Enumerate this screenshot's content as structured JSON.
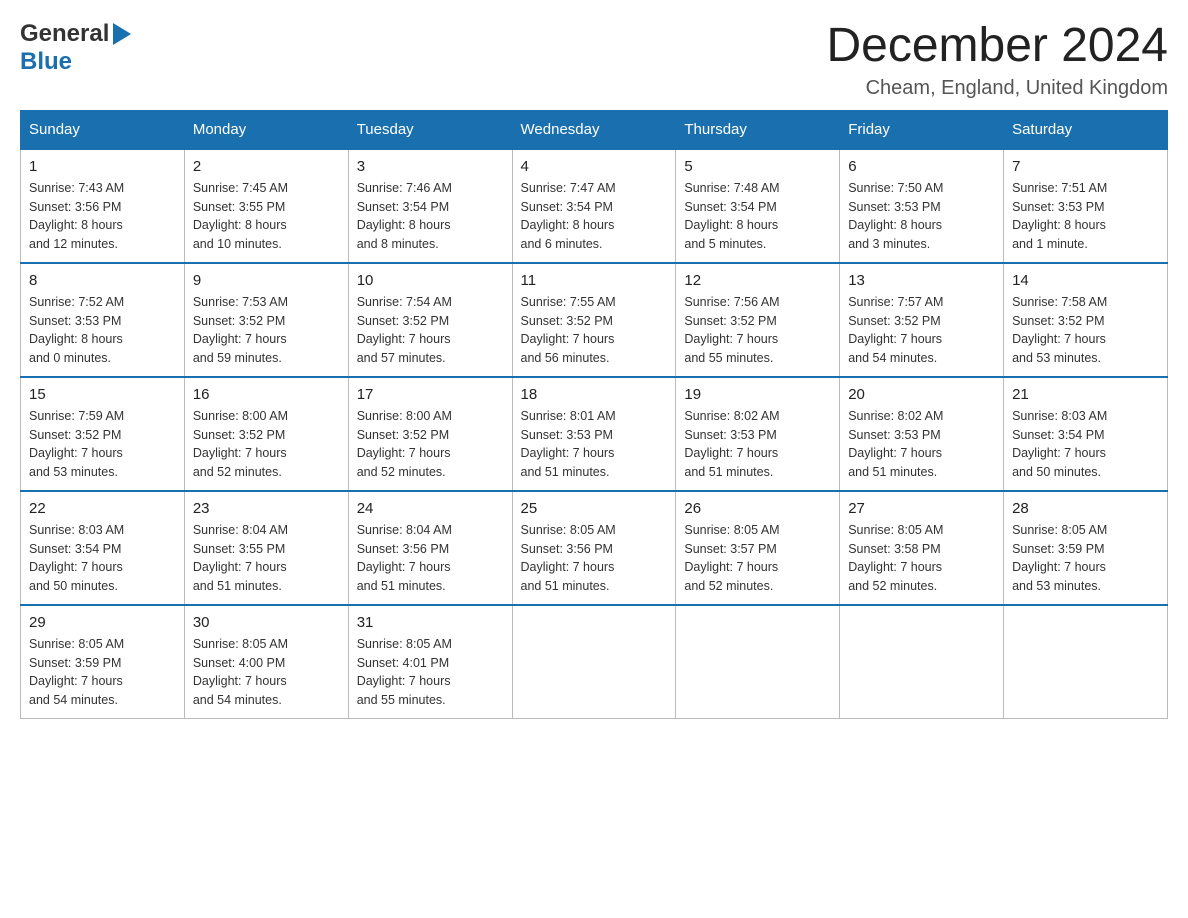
{
  "header": {
    "logo_general": "General",
    "logo_blue": "Blue",
    "month_title": "December 2024",
    "location": "Cheam, England, United Kingdom"
  },
  "weekdays": [
    "Sunday",
    "Monday",
    "Tuesday",
    "Wednesday",
    "Thursday",
    "Friday",
    "Saturday"
  ],
  "weeks": [
    [
      {
        "day": "1",
        "sunrise": "Sunrise: 7:43 AM",
        "sunset": "Sunset: 3:56 PM",
        "daylight": "Daylight: 8 hours",
        "daylight2": "and 12 minutes."
      },
      {
        "day": "2",
        "sunrise": "Sunrise: 7:45 AM",
        "sunset": "Sunset: 3:55 PM",
        "daylight": "Daylight: 8 hours",
        "daylight2": "and 10 minutes."
      },
      {
        "day": "3",
        "sunrise": "Sunrise: 7:46 AM",
        "sunset": "Sunset: 3:54 PM",
        "daylight": "Daylight: 8 hours",
        "daylight2": "and 8 minutes."
      },
      {
        "day": "4",
        "sunrise": "Sunrise: 7:47 AM",
        "sunset": "Sunset: 3:54 PM",
        "daylight": "Daylight: 8 hours",
        "daylight2": "and 6 minutes."
      },
      {
        "day": "5",
        "sunrise": "Sunrise: 7:48 AM",
        "sunset": "Sunset: 3:54 PM",
        "daylight": "Daylight: 8 hours",
        "daylight2": "and 5 minutes."
      },
      {
        "day": "6",
        "sunrise": "Sunrise: 7:50 AM",
        "sunset": "Sunset: 3:53 PM",
        "daylight": "Daylight: 8 hours",
        "daylight2": "and 3 minutes."
      },
      {
        "day": "7",
        "sunrise": "Sunrise: 7:51 AM",
        "sunset": "Sunset: 3:53 PM",
        "daylight": "Daylight: 8 hours",
        "daylight2": "and 1 minute."
      }
    ],
    [
      {
        "day": "8",
        "sunrise": "Sunrise: 7:52 AM",
        "sunset": "Sunset: 3:53 PM",
        "daylight": "Daylight: 8 hours",
        "daylight2": "and 0 minutes."
      },
      {
        "day": "9",
        "sunrise": "Sunrise: 7:53 AM",
        "sunset": "Sunset: 3:52 PM",
        "daylight": "Daylight: 7 hours",
        "daylight2": "and 59 minutes."
      },
      {
        "day": "10",
        "sunrise": "Sunrise: 7:54 AM",
        "sunset": "Sunset: 3:52 PM",
        "daylight": "Daylight: 7 hours",
        "daylight2": "and 57 minutes."
      },
      {
        "day": "11",
        "sunrise": "Sunrise: 7:55 AM",
        "sunset": "Sunset: 3:52 PM",
        "daylight": "Daylight: 7 hours",
        "daylight2": "and 56 minutes."
      },
      {
        "day": "12",
        "sunrise": "Sunrise: 7:56 AM",
        "sunset": "Sunset: 3:52 PM",
        "daylight": "Daylight: 7 hours",
        "daylight2": "and 55 minutes."
      },
      {
        "day": "13",
        "sunrise": "Sunrise: 7:57 AM",
        "sunset": "Sunset: 3:52 PM",
        "daylight": "Daylight: 7 hours",
        "daylight2": "and 54 minutes."
      },
      {
        "day": "14",
        "sunrise": "Sunrise: 7:58 AM",
        "sunset": "Sunset: 3:52 PM",
        "daylight": "Daylight: 7 hours",
        "daylight2": "and 53 minutes."
      }
    ],
    [
      {
        "day": "15",
        "sunrise": "Sunrise: 7:59 AM",
        "sunset": "Sunset: 3:52 PM",
        "daylight": "Daylight: 7 hours",
        "daylight2": "and 53 minutes."
      },
      {
        "day": "16",
        "sunrise": "Sunrise: 8:00 AM",
        "sunset": "Sunset: 3:52 PM",
        "daylight": "Daylight: 7 hours",
        "daylight2": "and 52 minutes."
      },
      {
        "day": "17",
        "sunrise": "Sunrise: 8:00 AM",
        "sunset": "Sunset: 3:52 PM",
        "daylight": "Daylight: 7 hours",
        "daylight2": "and 52 minutes."
      },
      {
        "day": "18",
        "sunrise": "Sunrise: 8:01 AM",
        "sunset": "Sunset: 3:53 PM",
        "daylight": "Daylight: 7 hours",
        "daylight2": "and 51 minutes."
      },
      {
        "day": "19",
        "sunrise": "Sunrise: 8:02 AM",
        "sunset": "Sunset: 3:53 PM",
        "daylight": "Daylight: 7 hours",
        "daylight2": "and 51 minutes."
      },
      {
        "day": "20",
        "sunrise": "Sunrise: 8:02 AM",
        "sunset": "Sunset: 3:53 PM",
        "daylight": "Daylight: 7 hours",
        "daylight2": "and 51 minutes."
      },
      {
        "day": "21",
        "sunrise": "Sunrise: 8:03 AM",
        "sunset": "Sunset: 3:54 PM",
        "daylight": "Daylight: 7 hours",
        "daylight2": "and 50 minutes."
      }
    ],
    [
      {
        "day": "22",
        "sunrise": "Sunrise: 8:03 AM",
        "sunset": "Sunset: 3:54 PM",
        "daylight": "Daylight: 7 hours",
        "daylight2": "and 50 minutes."
      },
      {
        "day": "23",
        "sunrise": "Sunrise: 8:04 AM",
        "sunset": "Sunset: 3:55 PM",
        "daylight": "Daylight: 7 hours",
        "daylight2": "and 51 minutes."
      },
      {
        "day": "24",
        "sunrise": "Sunrise: 8:04 AM",
        "sunset": "Sunset: 3:56 PM",
        "daylight": "Daylight: 7 hours",
        "daylight2": "and 51 minutes."
      },
      {
        "day": "25",
        "sunrise": "Sunrise: 8:05 AM",
        "sunset": "Sunset: 3:56 PM",
        "daylight": "Daylight: 7 hours",
        "daylight2": "and 51 minutes."
      },
      {
        "day": "26",
        "sunrise": "Sunrise: 8:05 AM",
        "sunset": "Sunset: 3:57 PM",
        "daylight": "Daylight: 7 hours",
        "daylight2": "and 52 minutes."
      },
      {
        "day": "27",
        "sunrise": "Sunrise: 8:05 AM",
        "sunset": "Sunset: 3:58 PM",
        "daylight": "Daylight: 7 hours",
        "daylight2": "and 52 minutes."
      },
      {
        "day": "28",
        "sunrise": "Sunrise: 8:05 AM",
        "sunset": "Sunset: 3:59 PM",
        "daylight": "Daylight: 7 hours",
        "daylight2": "and 53 minutes."
      }
    ],
    [
      {
        "day": "29",
        "sunrise": "Sunrise: 8:05 AM",
        "sunset": "Sunset: 3:59 PM",
        "daylight": "Daylight: 7 hours",
        "daylight2": "and 54 minutes."
      },
      {
        "day": "30",
        "sunrise": "Sunrise: 8:05 AM",
        "sunset": "Sunset: 4:00 PM",
        "daylight": "Daylight: 7 hours",
        "daylight2": "and 54 minutes."
      },
      {
        "day": "31",
        "sunrise": "Sunrise: 8:05 AM",
        "sunset": "Sunset: 4:01 PM",
        "daylight": "Daylight: 7 hours",
        "daylight2": "and 55 minutes."
      },
      null,
      null,
      null,
      null
    ]
  ]
}
